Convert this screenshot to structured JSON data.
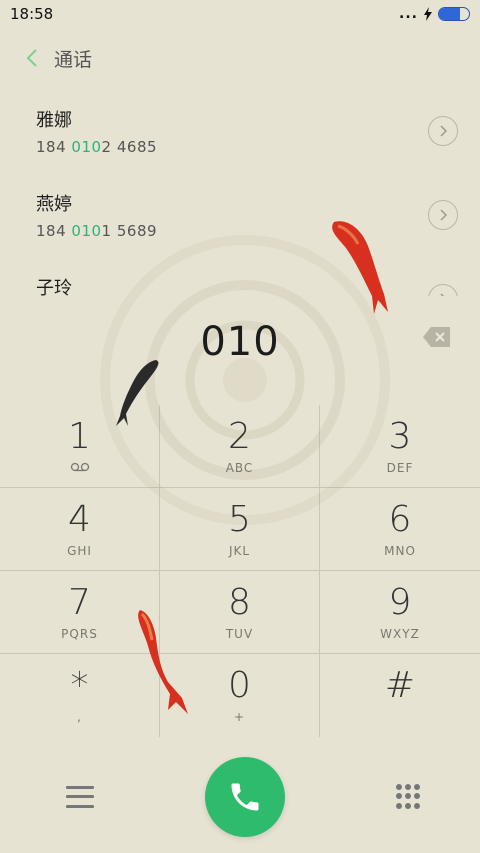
{
  "status": {
    "time": "18:58",
    "dots": "...",
    "charging_icon": "bolt-icon",
    "battery_level": 0.7,
    "battery_color": "#2f66d8"
  },
  "header": {
    "title": "通话",
    "back_icon": "chevron-left-icon"
  },
  "contacts": [
    {
      "name": "雅娜",
      "prefix": "184 ",
      "match": "010",
      "suffix": "2 4685"
    },
    {
      "name": "燕婷",
      "prefix": "184 ",
      "match": "010",
      "suffix": "1 5689"
    },
    {
      "name": "子玲"
    }
  ],
  "dialer": {
    "input": "010",
    "backspace_icon": "backspace-icon"
  },
  "keypad": [
    {
      "digit": "1",
      "letters": ""
    },
    {
      "digit": "2",
      "letters": "ABC"
    },
    {
      "digit": "3",
      "letters": "DEF"
    },
    {
      "digit": "4",
      "letters": "GHI"
    },
    {
      "digit": "5",
      "letters": "JKL"
    },
    {
      "digit": "6",
      "letters": "MNO"
    },
    {
      "digit": "7",
      "letters": "PQRS"
    },
    {
      "digit": "8",
      "letters": "TUV"
    },
    {
      "digit": "9",
      "letters": "WXYZ"
    },
    {
      "digit": "*",
      "letters": ","
    },
    {
      "digit": "0",
      "letters": "+"
    },
    {
      "digit": "#",
      "letters": ""
    }
  ],
  "bottom": {
    "menu_icon": "menu-icon",
    "call_icon": "phone-icon",
    "keypad_icon": "dialpad-icon"
  },
  "colors": {
    "accent_green": "#2fbb6d",
    "match_green": "#2ab47c",
    "background": "#e7e3d3"
  }
}
